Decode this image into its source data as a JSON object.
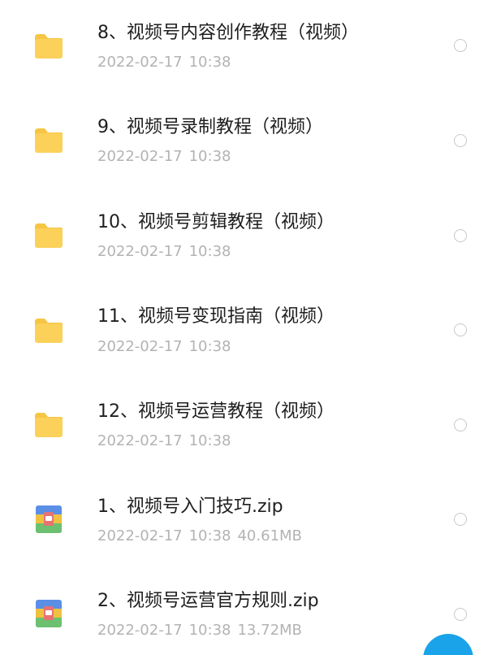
{
  "files": [
    {
      "name": "8、视频号内容创作教程（视频）",
      "date": "2022-02-17",
      "time": "10:38",
      "size": "",
      "type": "folder"
    },
    {
      "name": "9、视频号录制教程（视频）",
      "date": "2022-02-17",
      "time": "10:38",
      "size": "",
      "type": "folder"
    },
    {
      "name": "10、视频号剪辑教程（视频）",
      "date": "2022-02-17",
      "time": "10:38",
      "size": "",
      "type": "folder"
    },
    {
      "name": "11、视频号变现指南（视频）",
      "date": "2022-02-17",
      "time": "10:38",
      "size": "",
      "type": "folder"
    },
    {
      "name": "12、视频号运营教程（视频）",
      "date": "2022-02-17",
      "time": "10:38",
      "size": "",
      "type": "folder"
    },
    {
      "name": "1、视频号入门技巧.zip",
      "date": "2022-02-17",
      "time": "10:38",
      "size": "40.61MB",
      "type": "archive"
    },
    {
      "name": "2、视频号运营官方规则.zip",
      "date": "2022-02-17",
      "time": "10:38",
      "size": "13.72MB",
      "type": "archive"
    }
  ],
  "icons": {
    "folder": "folder-icon",
    "archive": "zip-archive-icon",
    "fab": "fab-button"
  },
  "colors": {
    "folder": "#fbd15a",
    "folder_tab": "#f6c543",
    "fab": "#1aa3e8",
    "title": "#1f1f1f",
    "meta": "#b3b3b3"
  }
}
